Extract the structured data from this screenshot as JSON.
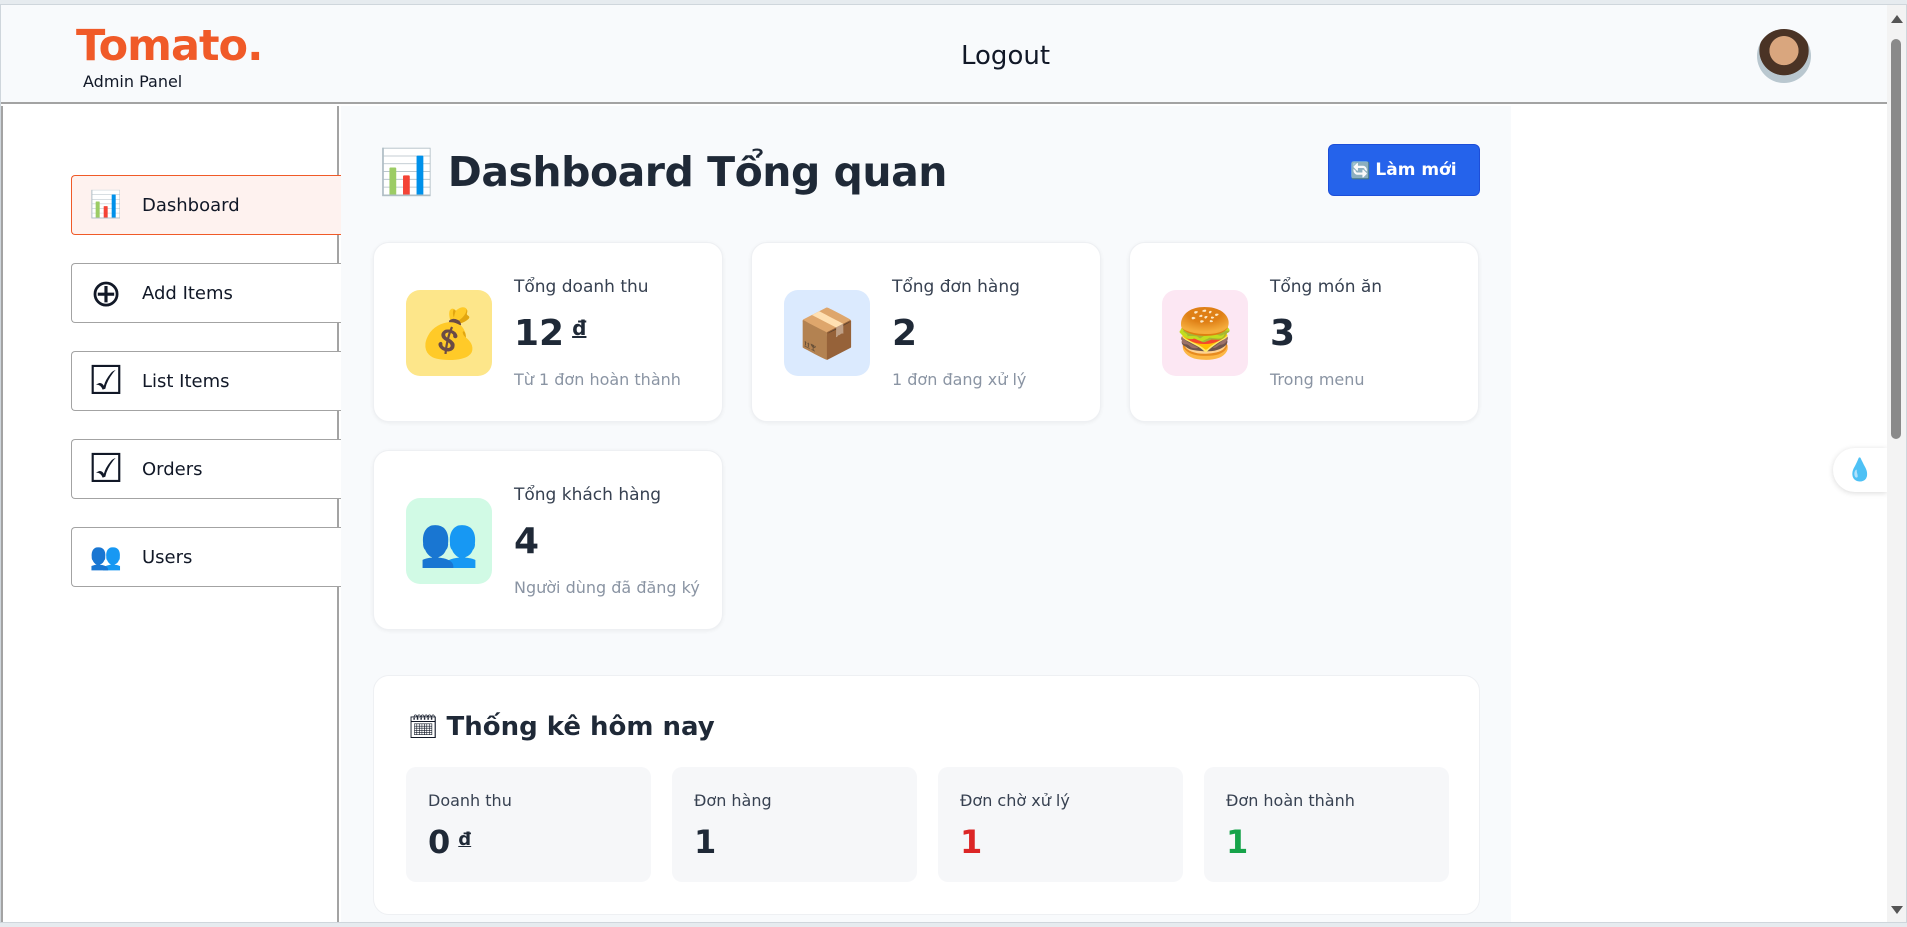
{
  "header": {
    "logo_name": "Tomato.",
    "logo_sub": "Admin Panel",
    "logout_label": "Logout"
  },
  "sidebar": {
    "items": [
      {
        "label": "Dashboard",
        "icon": "bar-chart-icon",
        "glyph": "📊",
        "active": true
      },
      {
        "label": "Add Items",
        "icon": "add-circle-icon",
        "glyph": "⊕",
        "active": false
      },
      {
        "label": "List Items",
        "icon": "checkbox-icon",
        "glyph": "☑",
        "active": false
      },
      {
        "label": "Orders",
        "icon": "checkbox-icon",
        "glyph": "☑",
        "active": false
      },
      {
        "label": "Users",
        "icon": "users-icon",
        "glyph": "👥",
        "active": false
      }
    ]
  },
  "main": {
    "title_icon": "📊",
    "title": "Dashboard Tổng quan",
    "refresh_icon": "🔄",
    "refresh_label": "Làm mới",
    "cards": [
      {
        "label": "Tổng doanh thu",
        "value": "12",
        "currency": "đ",
        "sub": "Từ 1 đơn hoàn thành",
        "icon": "money-bag-icon",
        "glyph": "💰",
        "bg": "#fde68a"
      },
      {
        "label": "Tổng đơn hàng",
        "value": "2",
        "currency": "",
        "sub": "1 đơn đang xử lý",
        "icon": "package-icon",
        "glyph": "📦",
        "bg": "#dbeafe"
      },
      {
        "label": "Tổng món ăn",
        "value": "3",
        "currency": "",
        "sub": "Trong menu",
        "icon": "burger-icon",
        "glyph": "🍔",
        "bg": "#fce7f3"
      },
      {
        "label": "Tổng khách hàng",
        "value": "4",
        "currency": "",
        "sub": "Người dùng đã đăng ký",
        "icon": "users-icon",
        "glyph": "👥",
        "bg": "#d1fae5"
      }
    ],
    "today": {
      "title_icon": "🗓",
      "title": "Thống kê hôm nay",
      "stats": [
        {
          "label": "Doanh thu",
          "value": "0",
          "currency": "đ",
          "color": "#1f2937"
        },
        {
          "label": "Đơn hàng",
          "value": "1",
          "currency": "",
          "color": "#1f2937"
        },
        {
          "label": "Đơn chờ xử lý",
          "value": "1",
          "currency": "",
          "color": "#dc2626"
        },
        {
          "label": "Đơn hoàn thành",
          "value": "1",
          "currency": "",
          "color": "#16a34a"
        }
      ]
    }
  },
  "colors": {
    "accent": "#f05a28",
    "primary_button": "#2563eb"
  }
}
